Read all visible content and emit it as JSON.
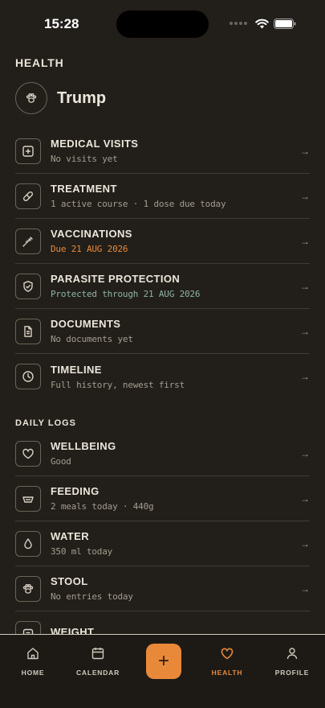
{
  "status": {
    "time": "15:28"
  },
  "page": {
    "title": "HEALTH",
    "pet_name": "Trump"
  },
  "records": [
    {
      "icon": "plus-square-icon",
      "title": "MEDICAL VISITS",
      "subtitle": "No visits yet",
      "tone": "muted"
    },
    {
      "icon": "pill-icon",
      "title": "TREATMENT",
      "subtitle": "1 active course · 1 dose due today",
      "tone": "muted"
    },
    {
      "icon": "syringe-icon",
      "title": "VACCINATIONS",
      "subtitle": "Due 21 AUG 2026",
      "tone": "accent"
    },
    {
      "icon": "shield-check-icon",
      "title": "PARASITE PROTECTION",
      "subtitle": "Protected through 21 AUG 2026",
      "tone": "ok"
    },
    {
      "icon": "document-icon",
      "title": "DOCUMENTS",
      "subtitle": "No documents yet",
      "tone": "muted"
    },
    {
      "icon": "clock-icon",
      "title": "TIMELINE",
      "subtitle": "Full history, newest first",
      "tone": "muted"
    }
  ],
  "daily_logs": {
    "label": "DAILY LOGS",
    "items": [
      {
        "icon": "heart-icon",
        "title": "WELLBEING",
        "subtitle": "Good",
        "tone": "muted"
      },
      {
        "icon": "bowl-icon",
        "title": "FEEDING",
        "subtitle": "2 meals today · 440g",
        "tone": "muted"
      },
      {
        "icon": "droplet-icon",
        "title": "WATER",
        "subtitle": "350 ml today",
        "tone": "muted"
      },
      {
        "icon": "paw-icon",
        "title": "STOOL",
        "subtitle": "No entries today",
        "tone": "muted"
      },
      {
        "icon": "scale-icon",
        "title": "WEIGHT",
        "subtitle": "",
        "tone": "muted"
      }
    ]
  },
  "arrow": "→",
  "tabs": [
    {
      "label": "HOME",
      "icon": "home-icon"
    },
    {
      "label": "CALENDAR",
      "icon": "calendar-icon"
    },
    {
      "label": "HEALTH",
      "icon": "heart-icon",
      "active": true
    },
    {
      "label": "PROFILE",
      "icon": "person-icon"
    }
  ],
  "fab": {
    "symbol": "+"
  },
  "colors": {
    "accent": "#e8893a",
    "ok": "#8fb3a8",
    "background": "#221f1a"
  }
}
